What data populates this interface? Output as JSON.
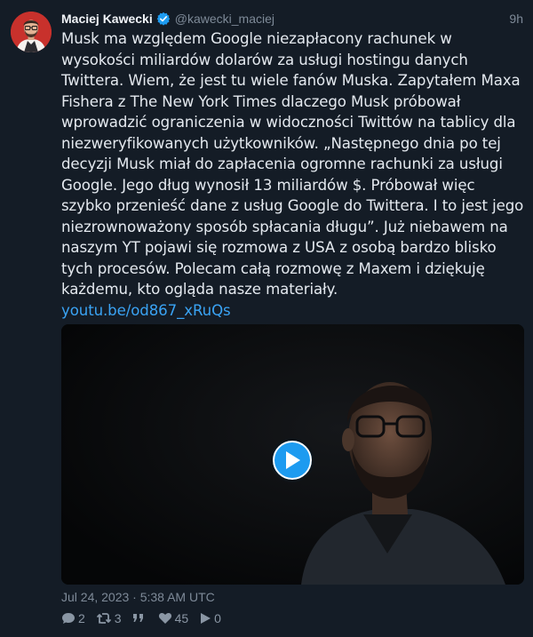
{
  "author": {
    "display_name": "Maciej Kawecki",
    "handle": "@kawecki_maciej",
    "verified": true
  },
  "tweet": {
    "relative_time": "9h",
    "text": "Musk ma względem Google niezapłacony rachunek w wysokości miliardów dolarów za usługi hostingu danych Twittera. Wiem, że jest tu wiele fanów Muska. Zapytałem Maxa Fishera z The New York Times dlaczego Musk próbował wprowadzić ograniczenia w widoczności Twittów na tablicy dla niezweryfikowanych użytkowników. „Następnego dnia po tej decyzji Musk miał do zapłacenia ogromne rachunki za usługi Google. Jego dług wynosił 13 miliardów $. Próbował więc szybko przenieść dane z usług Google do Twittera. I to jest jego niezrownoważony sposób spłacania długu”. Już niebawem na naszym YT pojawi się rozmowa z USA z osobą bardzo blisko tych procesów. Polecam całą rozmowę z Maxem i dziękuję każdemu, kto ogląda nasze materiały.",
    "link": "youtu.be/od867_xRuQs",
    "timestamp": "Jul 24, 2023 · 5:38 AM UTC"
  },
  "stats": {
    "replies": "2",
    "retweets": "3",
    "quotes": "",
    "likes": "45",
    "plays": "0"
  },
  "colors": {
    "background": "#141c26",
    "accent": "#1d9bf0",
    "link": "#3aa3f4",
    "muted": "#7e8a98"
  },
  "icons": {
    "verified": "verified-badge-icon",
    "play": "play-icon",
    "reply": "comment-icon",
    "retweet": "retweet-icon",
    "quote": "quote-icon",
    "like": "heart-icon",
    "views": "play-count-icon"
  }
}
